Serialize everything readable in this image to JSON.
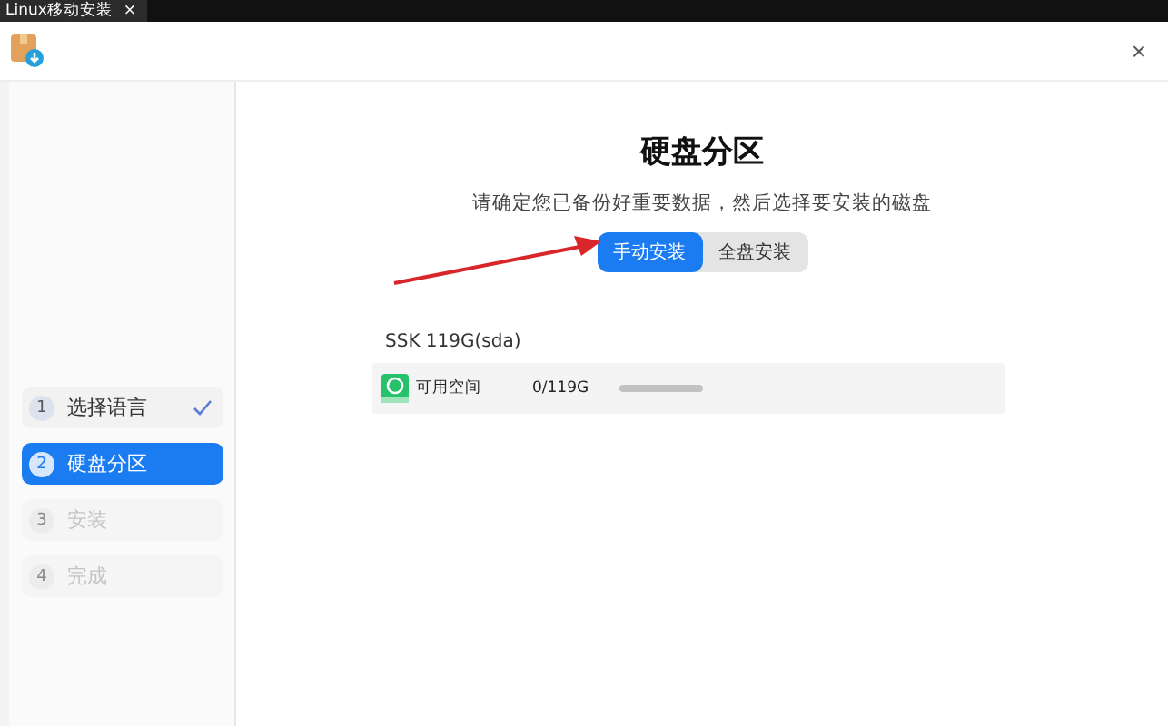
{
  "window": {
    "tab_title": "Linux移动安装",
    "tab_close": "×",
    "close": "×"
  },
  "steps": [
    {
      "number": "1",
      "label": "选择语言",
      "selected": false,
      "done": true,
      "disabled": false
    },
    {
      "number": "2",
      "label": "硬盘分区",
      "selected": true,
      "done": false,
      "disabled": false
    },
    {
      "number": "3",
      "label": "安装",
      "selected": false,
      "done": false,
      "disabled": true
    },
    {
      "number": "4",
      "label": "完成",
      "selected": false,
      "done": false,
      "disabled": true
    }
  ],
  "main": {
    "title": "硬盘分区",
    "subtitle": "请确定您已备份好重要数据，然后选择要安装的磁盘",
    "modes": [
      {
        "label": "手动安装",
        "selected": true
      },
      {
        "label": "全盘安装",
        "selected": false
      }
    ],
    "disk": {
      "name": "SSK  119G(sda)",
      "partitions": [
        {
          "label": "可用空间",
          "size": "0/119G"
        }
      ]
    }
  }
}
